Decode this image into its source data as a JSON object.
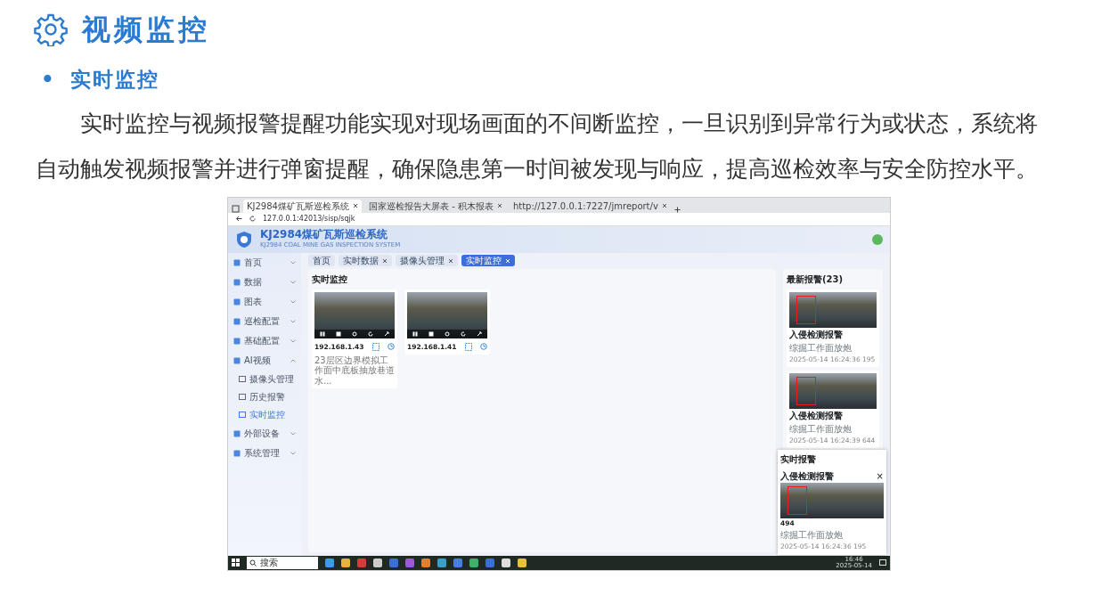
{
  "doc": {
    "title": "视频监控",
    "section_bullet": "•",
    "section": "实时监控",
    "paragraph": "实时监控与视频报警提醒功能实现对现场画面的不间断监控，一旦识别到异常行为或状态，系统将自动触发视频报警并进行弹窗提醒，确保隐患第一时间被发现与响应，提高巡检效率与安全防控水平。"
  },
  "screenshot": {
    "browser_tabs": [
      {
        "title": "KJ2984煤矿瓦斯巡检系统",
        "selected": true
      },
      {
        "title": "国家巡检报告大屏表 - 积木报表",
        "selected": false
      },
      {
        "title": "http://127.0.0.1:7227/jmreport/v",
        "selected": false
      }
    ],
    "address": "127.0.0.1:42013/sisp/sqjk",
    "app": {
      "name": "KJ2984煤矿瓦斯巡检系统",
      "subtitle": "KJ2984 COAL MINE GAS INSPECTION SYSTEM"
    },
    "sidebar": [
      {
        "label": "首页",
        "selected": false,
        "expanded": false
      },
      {
        "label": "数据",
        "selected": false,
        "expanded": false
      },
      {
        "label": "图表",
        "selected": false,
        "expanded": false
      },
      {
        "label": "巡检配置",
        "selected": false,
        "expanded": false
      },
      {
        "label": "基础配置",
        "selected": false,
        "expanded": false
      },
      {
        "label": "AI视频",
        "selected": false,
        "expanded": true,
        "children": [
          {
            "label": "摄像头管理",
            "selected": false
          },
          {
            "label": "历史报警",
            "selected": false
          },
          {
            "label": "实时监控",
            "selected": true
          }
        ]
      },
      {
        "label": "外部设备",
        "selected": false,
        "expanded": false
      },
      {
        "label": "系统管理",
        "selected": false,
        "expanded": false
      }
    ],
    "tabs": [
      {
        "label": "首页",
        "closable": false,
        "selected": false
      },
      {
        "label": "实时数据",
        "closable": true,
        "selected": false
      },
      {
        "label": "摄像头管理",
        "closable": true,
        "selected": false
      },
      {
        "label": "实时监控",
        "closable": true,
        "selected": true
      }
    ],
    "panel_title": "实时监控",
    "cameras": [
      {
        "ip": "192.168.1.43",
        "description": "23层区边界模拟工作面中底板抽放巷道水..."
      },
      {
        "ip": "192.168.1.41"
      }
    ],
    "alarm_list": {
      "title": "最新报警(23)",
      "items": [
        {
          "type": "入侵检测报警",
          "location": "综掘工作面放炮",
          "time": "2025-05-14 16:24:36 195"
        },
        {
          "type": "入侵检测报警",
          "location": "综掘工作面放炮",
          "time": "2025-05-14 16:24:39 644"
        }
      ]
    },
    "popup": {
      "title": "实时报警",
      "alarm": "入侵检测报警",
      "close": "×",
      "id": "494",
      "location": "综掘工作面放炮",
      "time": "2025-05-14 16:24:36 195"
    },
    "taskbar": {
      "search": "搜索",
      "time": "16:46",
      "date": "2025-05-14"
    }
  }
}
